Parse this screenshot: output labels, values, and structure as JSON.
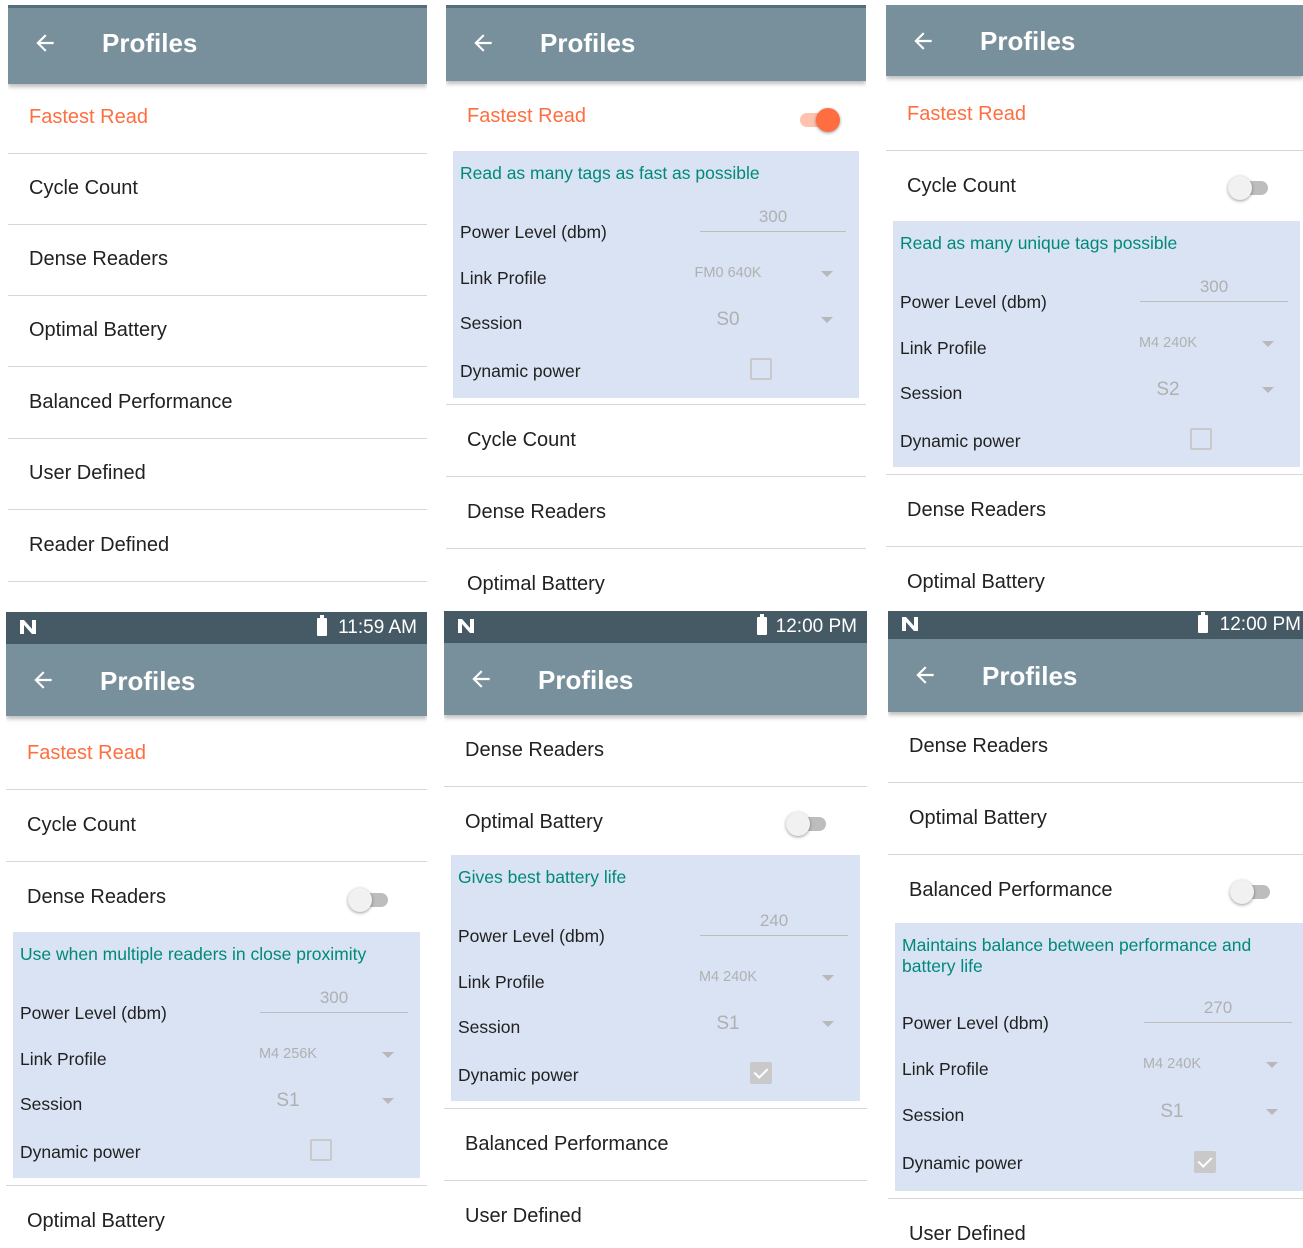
{
  "appbar": {
    "title": "Profiles",
    "back_icon": "arrow-left-icon"
  },
  "status": {
    "p4_time": "11:59 AM",
    "p5_time": "12:00 PM",
    "p6_time": "12:00 PM"
  },
  "colors": {
    "appbar": "#78909c",
    "statusbar": "#455a64",
    "accent": "#ff6e40",
    "desc": "#00897b",
    "details_bg": "#d9e3f3"
  },
  "field_labels": {
    "power": "Power Level (dbm)",
    "link": "Link Profile",
    "session": "Session",
    "dynamic": "Dynamic power"
  },
  "panels": {
    "p1": {
      "rows": [
        "Fastest Read",
        "Cycle Count",
        "Dense Readers",
        "Optimal Battery",
        "Balanced Performance",
        "User Defined",
        "Reader Defined"
      ]
    },
    "p2": {
      "selected": "Fastest Read",
      "toggle_on": true,
      "description": "Read as many tags as fast as possible",
      "power": "300",
      "link": "FM0 640K",
      "session": "S0",
      "dynamic_checked": false,
      "rows": [
        "Cycle Count",
        "Dense Readers",
        "Optimal Battery"
      ]
    },
    "p3": {
      "first": "Fastest Read",
      "selected": "Cycle Count",
      "toggle_on": false,
      "description": "Read as many unique tags possible",
      "power": "300",
      "link": "M4 240K",
      "session": "S2",
      "dynamic_checked": false,
      "rows": [
        "Dense Readers",
        "Optimal Battery"
      ]
    },
    "p4": {
      "first": "Fastest Read",
      "second": "Cycle Count",
      "selected": "Dense Readers",
      "toggle_on": false,
      "description": "Use when multiple readers in close proximity",
      "power": "300",
      "link": "M4 256K",
      "session": "S1",
      "dynamic_checked": false,
      "rows": [
        "Optimal Battery"
      ]
    },
    "p5": {
      "first": "Dense Readers",
      "selected": "Optimal Battery",
      "toggle_on": false,
      "description": "Gives best battery life",
      "power": "240",
      "link": "M4 240K",
      "session": "S1",
      "dynamic_checked": true,
      "rows": [
        "Balanced Performance",
        "User Defined"
      ]
    },
    "p6": {
      "first": "Dense Readers",
      "second": "Optimal Battery",
      "selected": "Balanced Performance",
      "toggle_on": false,
      "description": "Maintains balance between performance and battery life",
      "power": "270",
      "link": "M4 240K",
      "session": "S1",
      "dynamic_checked": true,
      "rows": [
        "User Defined"
      ]
    }
  }
}
